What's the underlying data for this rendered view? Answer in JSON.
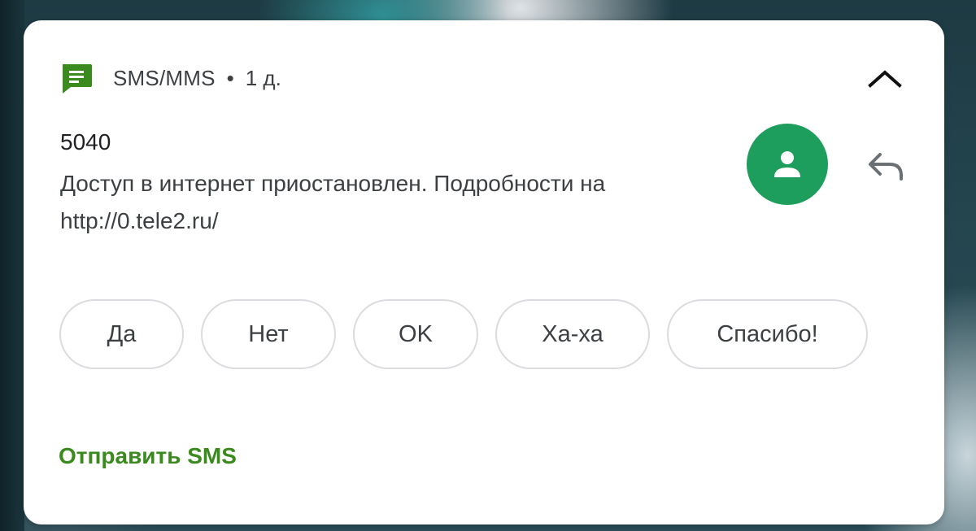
{
  "notification": {
    "app_name": "SMS/MMS",
    "separator": "•",
    "timestamp": "1 д.",
    "sender": "5040",
    "message_line1": "Доступ в интернет приостановлен. Подробности на",
    "message_line2": "http://0.tele2.ru/",
    "accent_color": "#3a8a1e",
    "avatar_color": "#1e9e5c",
    "icons": {
      "app": "messages-app-icon",
      "collapse": "chevron-up-icon",
      "avatar": "person-icon",
      "reply": "reply-icon"
    }
  },
  "smart_replies": [
    "Да",
    "Нет",
    "OK",
    "Ха-ха",
    "Спасибо!"
  ],
  "actions": {
    "send_sms": "Отправить SMS"
  }
}
